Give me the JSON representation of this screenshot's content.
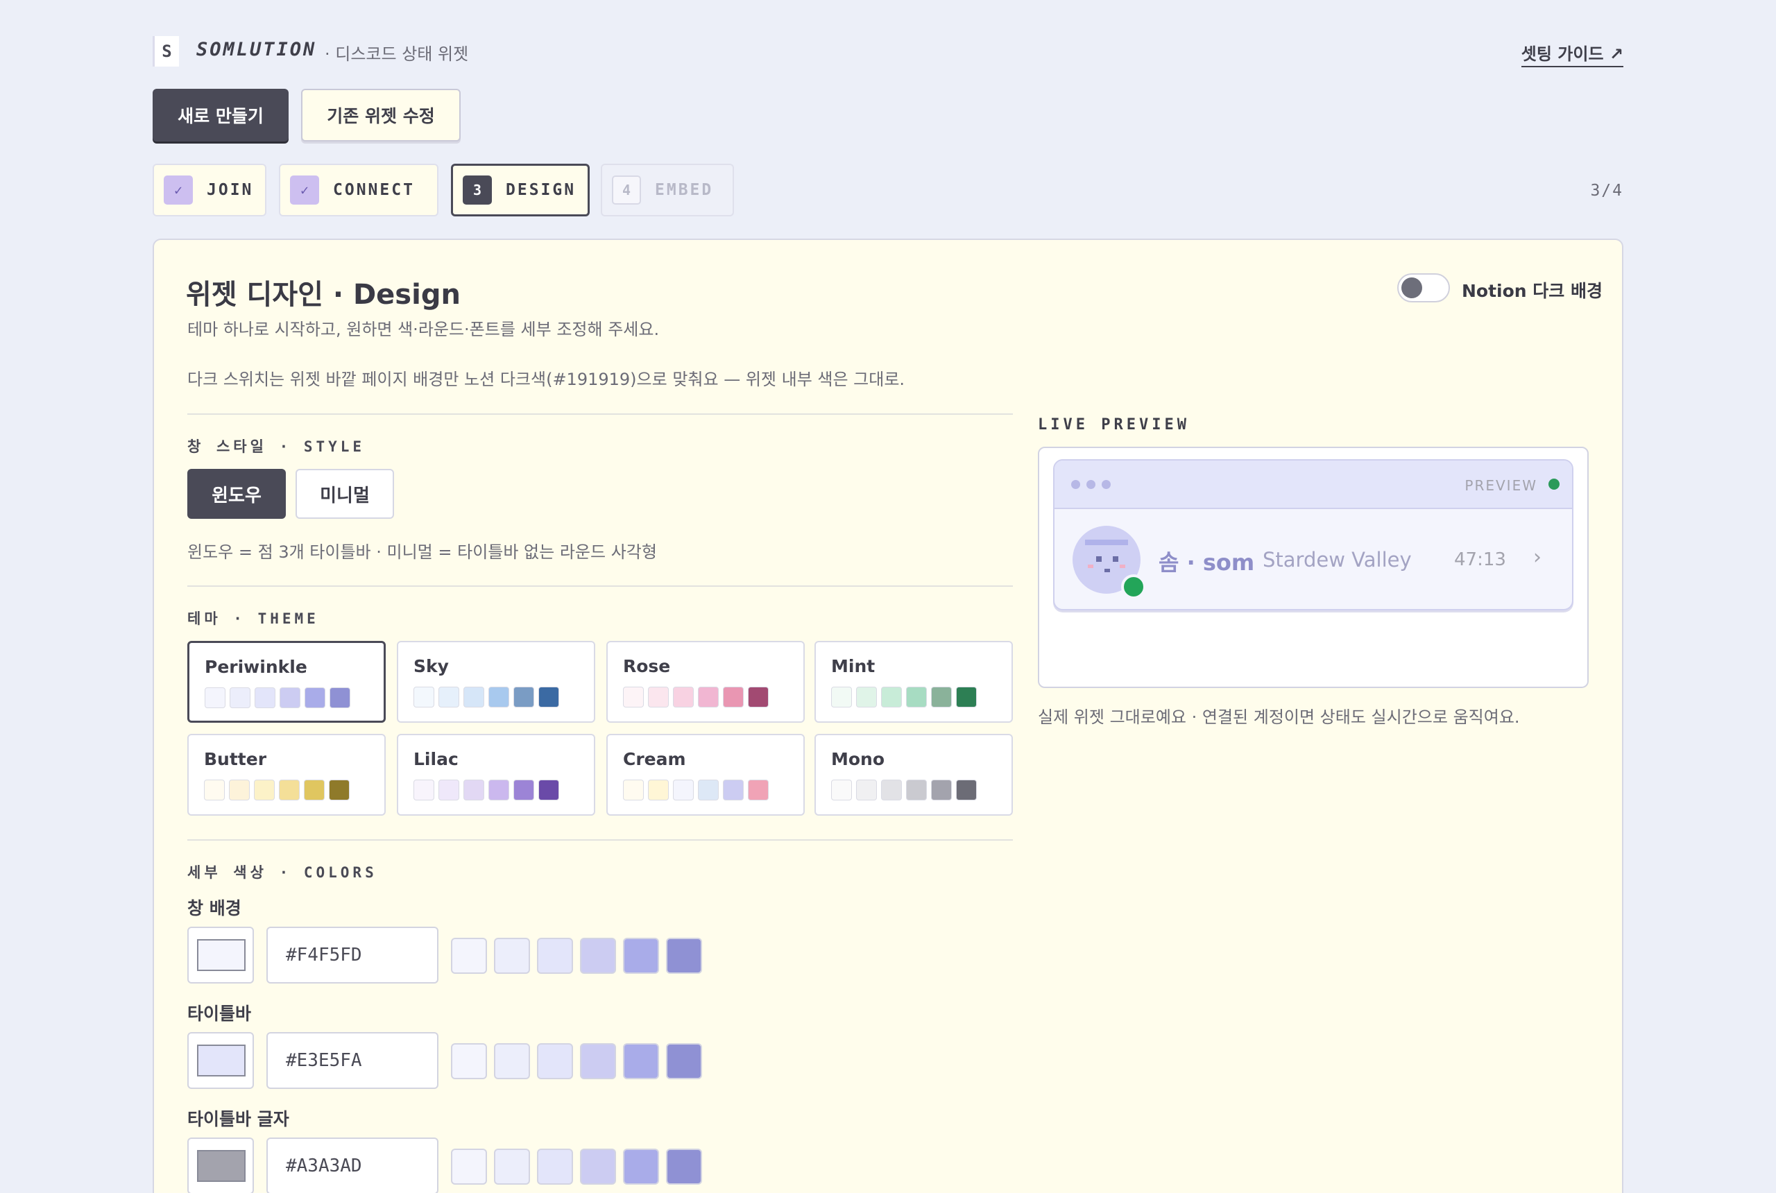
{
  "header": {
    "logo_letter": "S",
    "brand": "SOMLUTION",
    "subtitle": "· 디스코드 상태 위젯",
    "guide_link": "셋팅 가이드 ↗"
  },
  "mode": {
    "new_label": "새로 만들기",
    "edit_label": "기존 위젯 수정"
  },
  "steps": {
    "items": [
      {
        "badge": "✓",
        "label": "JOIN",
        "state": "done"
      },
      {
        "badge": "✓",
        "label": "CONNECT",
        "state": "done"
      },
      {
        "badge": "3",
        "label": "DESIGN",
        "state": "active"
      },
      {
        "badge": "4",
        "label": "EMBED",
        "state": "future"
      }
    ],
    "counter": "3/4"
  },
  "design": {
    "title": "위젯 디자인 · Design",
    "desc1": "테마 하나로 시작하고, 원하면 색·라운드·폰트를 세부 조정해 주세요.",
    "desc2": "다크 스위치는 위젯 바깥 페이지 배경만 노션 다크색(#191919)으로 맞춰요 — 위젯 내부 색은 그대로.",
    "dark_toggle_label": "Notion 다크 배경",
    "dark_toggle_on": false
  },
  "style": {
    "section": "창 스타일 · STYLE",
    "window_label": "윈도우",
    "minimal_label": "미니멀",
    "note": "윈도우 = 점 3개 타이틀바 · 미니멀 = 타이틀바 없는 라운드 사각형"
  },
  "theme": {
    "section": "테마 · THEME",
    "selected": "Periwinkle",
    "items": [
      {
        "name": "Periwinkle",
        "colors": [
          "#f4f5fd",
          "#eceefb",
          "#e3e5fa",
          "#ccccf2",
          "#a9ace9",
          "#8f91d4"
        ]
      },
      {
        "name": "Sky",
        "colors": [
          "#f3f8fd",
          "#e6f0fb",
          "#d6e6f8",
          "#a8c9ee",
          "#7a9cc4",
          "#3b6aa3"
        ]
      },
      {
        "name": "Rose",
        "colors": [
          "#fdf4f7",
          "#fbe6ee",
          "#f8d2e2",
          "#f1b6d2",
          "#e996b2",
          "#a24a72"
        ]
      },
      {
        "name": "Mint",
        "colors": [
          "#f2faf5",
          "#e0f4e8",
          "#c8ecd8",
          "#a7dcc2",
          "#8ab29a",
          "#2d7f54"
        ]
      },
      {
        "name": "Butter",
        "colors": [
          "#fffbf0",
          "#fdf3da",
          "#fcf2c8",
          "#f4df98",
          "#e0c660",
          "#8f7a2a"
        ]
      },
      {
        "name": "Lilac",
        "colors": [
          "#f8f4fc",
          "#efe8fa",
          "#e2d8f4",
          "#cbb8ee",
          "#9c84d6",
          "#6a4aa8"
        ]
      },
      {
        "name": "Cream",
        "colors": [
          "#fffbf0",
          "#fff6d6",
          "#f4f5fd",
          "#dde8f6",
          "#ccccf2",
          "#f0a3b6"
        ]
      },
      {
        "name": "Mono",
        "colors": [
          "#fafafa",
          "#f0f0f2",
          "#e2e2e6",
          "#cacad0",
          "#a3a3ad",
          "#6c6c76"
        ]
      }
    ]
  },
  "colors": {
    "section": "세부 색상 · COLORS",
    "palette": [
      "#f4f5fd",
      "#eceefb",
      "#e3e5fa",
      "#ccccf2",
      "#a9ace9",
      "#8f91d4"
    ],
    "fields": [
      {
        "label": "창 배경",
        "value": "#F4F5FD",
        "swatch": "#f4f5fd"
      },
      {
        "label": "타이틀바",
        "value": "#E3E5FA",
        "swatch": "#e3e5fa"
      },
      {
        "label": "타이틀바 글자",
        "value": "#A3A3AD",
        "swatch": "#a3a3ad"
      }
    ]
  },
  "preview": {
    "section": "LIVE PREVIEW",
    "tag": "PREVIEW",
    "name": "솜 · som",
    "game": "Stardew Valley",
    "time": "47:13",
    "chevron": "›",
    "note": "실제 위젯 그대로예요 · 연결된 계정이면 상태도 실시간으로 움직여요."
  }
}
